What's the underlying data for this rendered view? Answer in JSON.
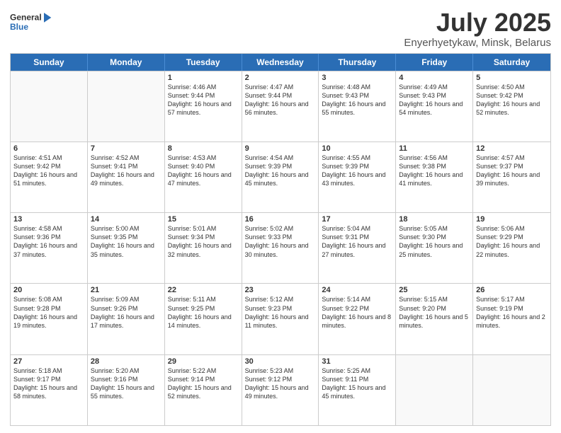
{
  "header": {
    "logo_line1": "General",
    "logo_line2": "Blue",
    "title": "July 2025",
    "subtitle": "Enyerhyetykaw, Minsk, Belarus"
  },
  "days_of_week": [
    "Sunday",
    "Monday",
    "Tuesday",
    "Wednesday",
    "Thursday",
    "Friday",
    "Saturday"
  ],
  "weeks": [
    [
      {
        "day": "",
        "sunrise": "",
        "sunset": "",
        "daylight": "",
        "empty": true
      },
      {
        "day": "",
        "sunrise": "",
        "sunset": "",
        "daylight": "",
        "empty": true
      },
      {
        "day": "1",
        "sunrise": "Sunrise: 4:46 AM",
        "sunset": "Sunset: 9:44 PM",
        "daylight": "Daylight: 16 hours and 57 minutes."
      },
      {
        "day": "2",
        "sunrise": "Sunrise: 4:47 AM",
        "sunset": "Sunset: 9:44 PM",
        "daylight": "Daylight: 16 hours and 56 minutes."
      },
      {
        "day": "3",
        "sunrise": "Sunrise: 4:48 AM",
        "sunset": "Sunset: 9:43 PM",
        "daylight": "Daylight: 16 hours and 55 minutes."
      },
      {
        "day": "4",
        "sunrise": "Sunrise: 4:49 AM",
        "sunset": "Sunset: 9:43 PM",
        "daylight": "Daylight: 16 hours and 54 minutes."
      },
      {
        "day": "5",
        "sunrise": "Sunrise: 4:50 AM",
        "sunset": "Sunset: 9:42 PM",
        "daylight": "Daylight: 16 hours and 52 minutes."
      }
    ],
    [
      {
        "day": "6",
        "sunrise": "Sunrise: 4:51 AM",
        "sunset": "Sunset: 9:42 PM",
        "daylight": "Daylight: 16 hours and 51 minutes."
      },
      {
        "day": "7",
        "sunrise": "Sunrise: 4:52 AM",
        "sunset": "Sunset: 9:41 PM",
        "daylight": "Daylight: 16 hours and 49 minutes."
      },
      {
        "day": "8",
        "sunrise": "Sunrise: 4:53 AM",
        "sunset": "Sunset: 9:40 PM",
        "daylight": "Daylight: 16 hours and 47 minutes."
      },
      {
        "day": "9",
        "sunrise": "Sunrise: 4:54 AM",
        "sunset": "Sunset: 9:39 PM",
        "daylight": "Daylight: 16 hours and 45 minutes."
      },
      {
        "day": "10",
        "sunrise": "Sunrise: 4:55 AM",
        "sunset": "Sunset: 9:39 PM",
        "daylight": "Daylight: 16 hours and 43 minutes."
      },
      {
        "day": "11",
        "sunrise": "Sunrise: 4:56 AM",
        "sunset": "Sunset: 9:38 PM",
        "daylight": "Daylight: 16 hours and 41 minutes."
      },
      {
        "day": "12",
        "sunrise": "Sunrise: 4:57 AM",
        "sunset": "Sunset: 9:37 PM",
        "daylight": "Daylight: 16 hours and 39 minutes."
      }
    ],
    [
      {
        "day": "13",
        "sunrise": "Sunrise: 4:58 AM",
        "sunset": "Sunset: 9:36 PM",
        "daylight": "Daylight: 16 hours and 37 minutes."
      },
      {
        "day": "14",
        "sunrise": "Sunrise: 5:00 AM",
        "sunset": "Sunset: 9:35 PM",
        "daylight": "Daylight: 16 hours and 35 minutes."
      },
      {
        "day": "15",
        "sunrise": "Sunrise: 5:01 AM",
        "sunset": "Sunset: 9:34 PM",
        "daylight": "Daylight: 16 hours and 32 minutes."
      },
      {
        "day": "16",
        "sunrise": "Sunrise: 5:02 AM",
        "sunset": "Sunset: 9:33 PM",
        "daylight": "Daylight: 16 hours and 30 minutes."
      },
      {
        "day": "17",
        "sunrise": "Sunrise: 5:04 AM",
        "sunset": "Sunset: 9:31 PM",
        "daylight": "Daylight: 16 hours and 27 minutes."
      },
      {
        "day": "18",
        "sunrise": "Sunrise: 5:05 AM",
        "sunset": "Sunset: 9:30 PM",
        "daylight": "Daylight: 16 hours and 25 minutes."
      },
      {
        "day": "19",
        "sunrise": "Sunrise: 5:06 AM",
        "sunset": "Sunset: 9:29 PM",
        "daylight": "Daylight: 16 hours and 22 minutes."
      }
    ],
    [
      {
        "day": "20",
        "sunrise": "Sunrise: 5:08 AM",
        "sunset": "Sunset: 9:28 PM",
        "daylight": "Daylight: 16 hours and 19 minutes."
      },
      {
        "day": "21",
        "sunrise": "Sunrise: 5:09 AM",
        "sunset": "Sunset: 9:26 PM",
        "daylight": "Daylight: 16 hours and 17 minutes."
      },
      {
        "day": "22",
        "sunrise": "Sunrise: 5:11 AM",
        "sunset": "Sunset: 9:25 PM",
        "daylight": "Daylight: 16 hours and 14 minutes."
      },
      {
        "day": "23",
        "sunrise": "Sunrise: 5:12 AM",
        "sunset": "Sunset: 9:23 PM",
        "daylight": "Daylight: 16 hours and 11 minutes."
      },
      {
        "day": "24",
        "sunrise": "Sunrise: 5:14 AM",
        "sunset": "Sunset: 9:22 PM",
        "daylight": "Daylight: 16 hours and 8 minutes."
      },
      {
        "day": "25",
        "sunrise": "Sunrise: 5:15 AM",
        "sunset": "Sunset: 9:20 PM",
        "daylight": "Daylight: 16 hours and 5 minutes."
      },
      {
        "day": "26",
        "sunrise": "Sunrise: 5:17 AM",
        "sunset": "Sunset: 9:19 PM",
        "daylight": "Daylight: 16 hours and 2 minutes."
      }
    ],
    [
      {
        "day": "27",
        "sunrise": "Sunrise: 5:18 AM",
        "sunset": "Sunset: 9:17 PM",
        "daylight": "Daylight: 15 hours and 58 minutes."
      },
      {
        "day": "28",
        "sunrise": "Sunrise: 5:20 AM",
        "sunset": "Sunset: 9:16 PM",
        "daylight": "Daylight: 15 hours and 55 minutes."
      },
      {
        "day": "29",
        "sunrise": "Sunrise: 5:22 AM",
        "sunset": "Sunset: 9:14 PM",
        "daylight": "Daylight: 15 hours and 52 minutes."
      },
      {
        "day": "30",
        "sunrise": "Sunrise: 5:23 AM",
        "sunset": "Sunset: 9:12 PM",
        "daylight": "Daylight: 15 hours and 49 minutes."
      },
      {
        "day": "31",
        "sunrise": "Sunrise: 5:25 AM",
        "sunset": "Sunset: 9:11 PM",
        "daylight": "Daylight: 15 hours and 45 minutes."
      },
      {
        "day": "",
        "sunrise": "",
        "sunset": "",
        "daylight": "",
        "empty": true
      },
      {
        "day": "",
        "sunrise": "",
        "sunset": "",
        "daylight": "",
        "empty": true
      }
    ]
  ]
}
